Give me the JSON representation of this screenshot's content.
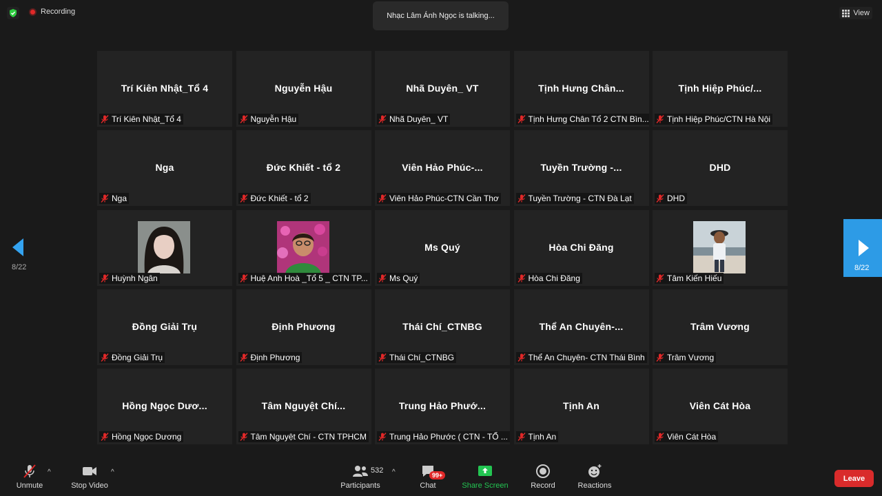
{
  "top": {
    "recording_label": "Recording",
    "talking": "Nhạc Lâm Ánh Ngọc is talking...",
    "view_label": "View"
  },
  "pagination": {
    "left": "8/22",
    "right": "8/22"
  },
  "participants": [
    {
      "name": "Trí Kiên Nhật_Tổ 4",
      "label": "Trí Kiên Nhật_Tổ 4"
    },
    {
      "name": "Nguyễn Hậu",
      "label": "Nguyễn Hậu"
    },
    {
      "name": "Nhã Duyên_ VT",
      "label": "Nhã Duyên_ VT"
    },
    {
      "name": "Tịnh Hưng Chân...",
      "label": "Tịnh Hưng Chân Tổ 2 CTN Bìn..."
    },
    {
      "name": "Tịnh Hiệp Phúc/...",
      "label": "Tịnh Hiệp Phúc/CTN Hà Nội"
    },
    {
      "name": "Nga",
      "label": "Nga"
    },
    {
      "name": "Đức Khiết - tổ 2",
      "label": "Đức Khiết - tổ 2"
    },
    {
      "name": "Viên Hảo Phúc-...",
      "label": "Viên Hảo Phúc-CTN Cần Thơ"
    },
    {
      "name": "Tuyền Trường -...",
      "label": "Tuyền Trường - CTN Đà Lạt"
    },
    {
      "name": "DHD",
      "label": "DHD"
    },
    {
      "name": "",
      "label": "Huỳnh Ngân",
      "photo": "long-hair-woman"
    },
    {
      "name": "",
      "label": "Huệ Anh Hoà _Tổ 5 _ CTN TP...",
      "photo": "woman-flowers"
    },
    {
      "name": "Ms Quý",
      "label": "Ms Quý"
    },
    {
      "name": "Hòa Chi Đăng",
      "label": "Hòa Chi Đăng"
    },
    {
      "name": "",
      "label": "Tâm Kiến Hiếu",
      "photo": "person-beach"
    },
    {
      "name": "Đồng Giải Trụ",
      "label": "Đồng Giải Trụ"
    },
    {
      "name": "Định Phương",
      "label": "Định Phương"
    },
    {
      "name": "Thái Chí_CTNBG",
      "label": "Thái Chí_CTNBG"
    },
    {
      "name": "Thể An Chuyên-...",
      "label": "Thể An Chuyên- CTN Thái Bình"
    },
    {
      "name": "Trâm Vương",
      "label": "Trâm Vương"
    },
    {
      "name": "Hồng Ngọc Dươ...",
      "label": "Hồng Ngọc Dương"
    },
    {
      "name": "Tâm Nguyệt Chí...",
      "label": "Tâm Nguyệt Chí - CTN TPHCM"
    },
    {
      "name": "Trung Hảo Phướ...",
      "label": "Trung Hảo Phước ( CTN - TỔ ..."
    },
    {
      "name": "Tịnh An",
      "label": "Tịnh An"
    },
    {
      "name": "Viên Cát Hòa",
      "label": "Viên Cát Hòa"
    }
  ],
  "toolbar": {
    "unmute": "Unmute",
    "stop_video": "Stop Video",
    "participants": "Participants",
    "participants_count": "532",
    "chat": "Chat",
    "chat_badge": "99+",
    "share_screen": "Share Screen",
    "record": "Record",
    "reactions": "Reactions",
    "leave": "Leave"
  },
  "colors": {
    "accent": "#2d9be6",
    "share_green": "#23c552",
    "leave_red": "#d92b2b",
    "mic_off_red": "#e02828"
  }
}
